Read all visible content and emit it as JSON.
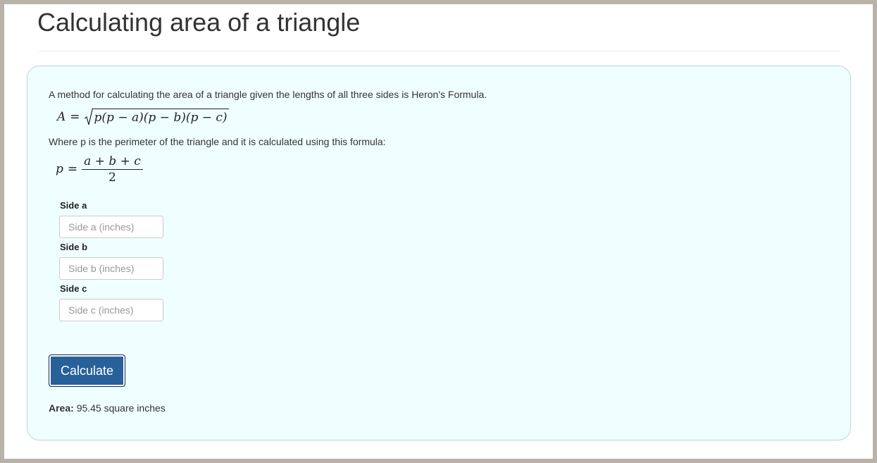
{
  "page": {
    "title": "Calculating area of a triangle"
  },
  "content": {
    "intro": "A method for calculating the area of a triangle given the lengths of all three sides is Heron's Formula.",
    "heron_formula": {
      "lhs": "A",
      "eq": "=",
      "radicand": "p(p − a)(p − b)(p − c)"
    },
    "perimeter_intro": "Where p is the perimeter of the triangle and it is calculated using this formula:",
    "perimeter_formula": {
      "lhs": "p",
      "eq": "=",
      "numerator": "a + b + c",
      "denominator": "2"
    }
  },
  "form": {
    "side_a": {
      "label": "Side a",
      "placeholder": "Side a (inches)",
      "value": ""
    },
    "side_b": {
      "label": "Side b",
      "placeholder": "Side b (inches)",
      "value": ""
    },
    "side_c": {
      "label": "Side c",
      "placeholder": "Side c (inches)",
      "value": ""
    },
    "submit_label": "Calculate"
  },
  "result": {
    "label": "Area:",
    "value": "95.45 square inches"
  },
  "colors": {
    "frame": "#b9b2a8",
    "panel_background": "#efffff",
    "panel_border": "#b8d6e0",
    "button_background": "#28609a",
    "button_text": "#ffffff"
  }
}
